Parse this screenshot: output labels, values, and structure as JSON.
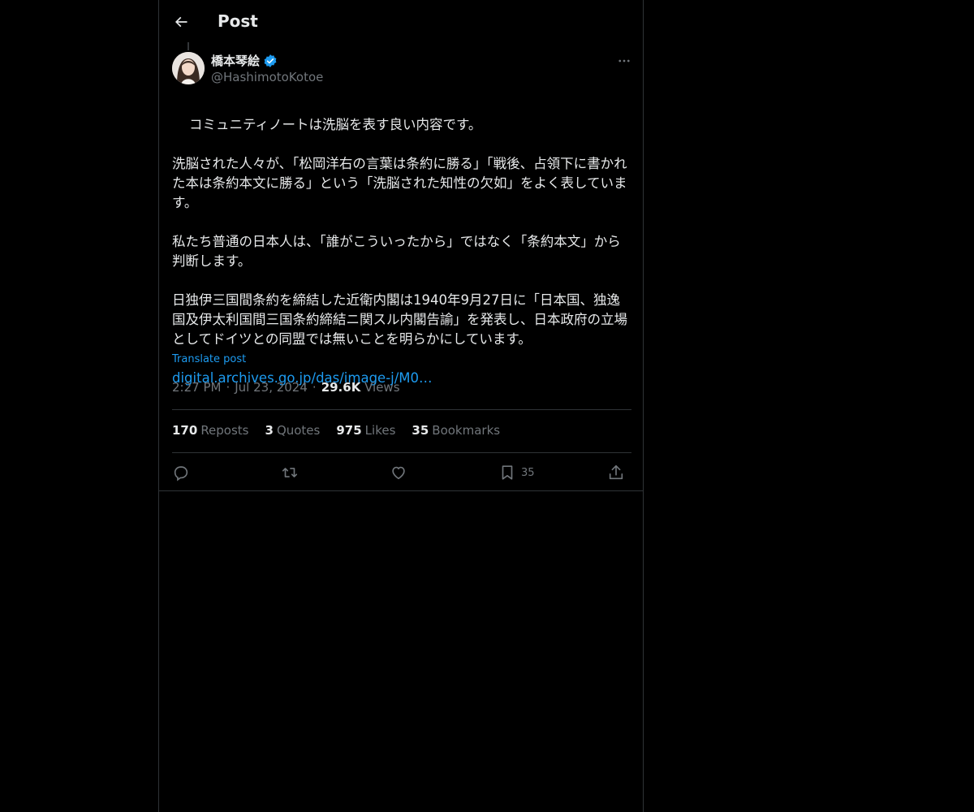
{
  "header": {
    "title": "Post"
  },
  "author": {
    "display_name": "橋本琴絵",
    "handle": "@HashimotoKotoe",
    "verified": true
  },
  "post": {
    "text": "コミュニティノートは洗脳を表す良い内容です。\n\n洗脳された人々が、「松岡洋右の言葉は条約に勝る」「戦後、占領下に書かれた本は条約本文に勝る」という「洗脳された知性の欠如」をよく表しています。\n\n私たち普通の日本人は、「誰がこういったから」ではなく「条約本文」から判断します。\n\n日独伊三国間条約を締結した近衛内閣は1940年9月27日に「日本国、独逸国及伊太利国間三国条約締結ニ関スル内閣告諭」を発表し、日本政府の立場としてドイツとの同盟では無いことを明らかにしています。",
    "link": "digital.archives.go.jp/das/image-j/M0…",
    "translate_label": "Translate post"
  },
  "meta": {
    "time": "2:27 PM",
    "sep1": "·",
    "date": "Jul 23, 2024",
    "sep2": "·",
    "views_count": "29.6K",
    "views_label": "Views"
  },
  "stats": {
    "reposts": {
      "count": "170",
      "label": "Reposts"
    },
    "quotes": {
      "count": "3",
      "label": "Quotes"
    },
    "likes": {
      "count": "975",
      "label": "Likes"
    },
    "bookmarks": {
      "count": "35",
      "label": "Bookmarks"
    }
  },
  "actions": {
    "bookmark_count": "35"
  },
  "icons": {
    "back": "arrow-left-icon",
    "verified": "verified-badge-icon",
    "more": "more-horizontal-icon",
    "reply": "reply-icon",
    "repost": "repost-icon",
    "like": "heart-icon",
    "bookmark": "bookmark-icon",
    "share": "share-icon"
  },
  "colors": {
    "background": "#000000",
    "text": "#e7e9ea",
    "secondary": "#71767b",
    "accent": "#1d9bf0",
    "border": "#2f3336"
  }
}
